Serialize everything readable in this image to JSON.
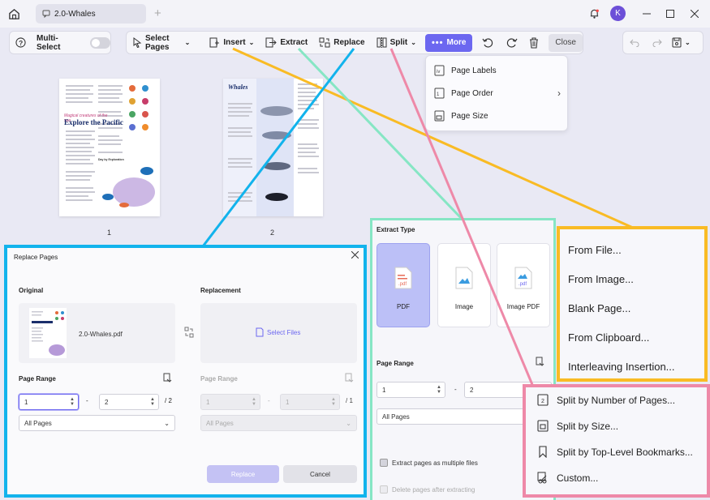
{
  "tab": {
    "title": "2.0-Whales"
  },
  "user": {
    "initial": "K"
  },
  "toolbar": {
    "multi_select": "Multi-Select",
    "select_pages": "Select Pages",
    "insert": "Insert",
    "extract": "Extract",
    "replace": "Replace",
    "split": "Split",
    "more": "More",
    "close": "Close"
  },
  "more_menu": {
    "items": [
      "Page Labels",
      "Page Order",
      "Page Size"
    ]
  },
  "thumbnails": {
    "page1": {
      "number": "1",
      "heading": "Explore the Pacific",
      "tagline": "Magical creatures of the sea",
      "section": "Day by Exploration"
    },
    "page2": {
      "number": "2",
      "title": "Whales"
    }
  },
  "replace_dialog": {
    "title": "Replace Pages",
    "original_label": "Original",
    "replacement_label": "Replacement",
    "file_name": "2.0-Whales.pdf",
    "select_files": "Select Files",
    "page_range_label": "Page Range",
    "orig_from": "1",
    "orig_to": "2",
    "orig_total": "/ 2",
    "repl_from": "1",
    "repl_to": "1",
    "repl_total": "/ 1",
    "all_pages": "All Pages",
    "dash": "-",
    "replace_btn": "Replace",
    "cancel_btn": "Cancel"
  },
  "extract_panel": {
    "type_label": "Extract Type",
    "types": [
      "PDF",
      "Image",
      "Image PDF"
    ],
    "page_range_label": "Page Range",
    "from": "1",
    "to": "2",
    "dash": "-",
    "all_pages": "All Pages",
    "opt_multiple": "Extract pages as multiple files",
    "opt_delete": "Delete pages after extracting"
  },
  "insert_options": {
    "items": [
      "From File...",
      "From Image...",
      "Blank Page...",
      "From Clipboard...",
      "Interleaving Insertion..."
    ]
  },
  "split_options": {
    "items": [
      "Split by Number of Pages...",
      "Split by Size...",
      "Split by Top-Level Bookmarks...",
      "Custom..."
    ]
  },
  "colors": {
    "replace_highlight": "#12b3ec",
    "extract_highlight": "#86e6c4",
    "insert_highlight": "#f9bb24",
    "split_highlight": "#ee89a8",
    "accent": "#6c67f0"
  }
}
